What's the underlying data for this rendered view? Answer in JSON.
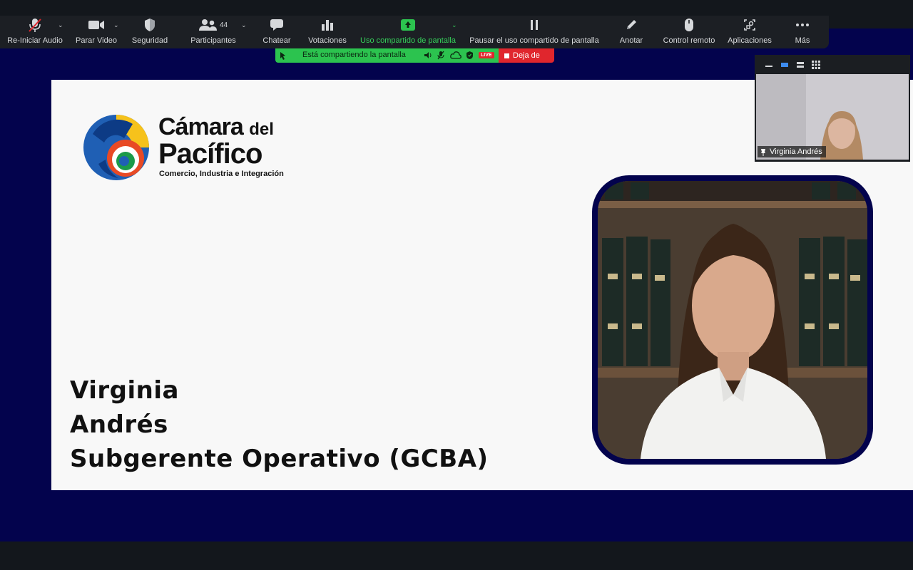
{
  "toolbar": {
    "audio_label": "Re-Iniciar Audio",
    "video_label": "Parar Video",
    "security_label": "Seguridad",
    "participants_label": "Participantes",
    "participants_count": "44",
    "chat_label": "Chatear",
    "polls_label": "Votaciones",
    "share_label": "Uso compartido de pantalla",
    "pause_share_label": "Pausar el uso compartido de pantalla",
    "annotate_label": "Anotar",
    "remote_label": "Control remoto",
    "apps_label": "Aplicaciones",
    "more_label": "Más"
  },
  "share_banner": {
    "status_text": "Está compartiendo la pantalla",
    "live_badge": "LIVE",
    "stop_label": "Deja de"
  },
  "slide": {
    "logo_line1": "Cámara",
    "logo_line1_small": "del",
    "logo_line2": "Pacífico",
    "logo_tagline": "Comercio, Industria e Integración",
    "name_first": "Virginia",
    "name_last": "Andrés",
    "role": "Subgerente Operativo (GCBA)"
  },
  "video_panel": {
    "participant_name": "Virginia Andrés"
  },
  "colors": {
    "share_background": "#03034d",
    "toolbar_background": "#1c1f24",
    "share_green": "#2cc34f",
    "stop_red": "#e0262d"
  },
  "icons": [
    "mic-muted-icon",
    "video-camera-icon",
    "shield-icon",
    "participants-icon",
    "chat-bubble-icon",
    "bar-chart-icon",
    "share-screen-icon",
    "pause-icon",
    "pencil-icon",
    "mouse-icon",
    "apps-icon",
    "more-dots-icon"
  ]
}
